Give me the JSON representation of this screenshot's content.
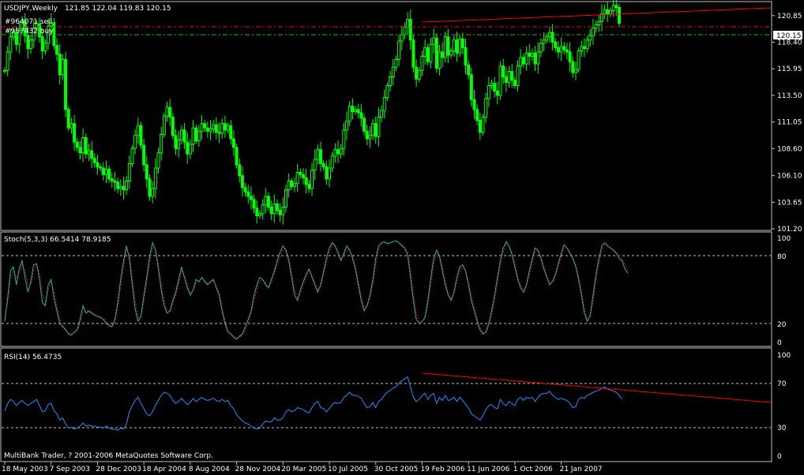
{
  "colors": {
    "background": "#000000",
    "frame": "#c0c0c0",
    "candle": "#00ff00",
    "trendline": "#ff0000",
    "sell_line": "#ff0000",
    "buy_line": "#00c000",
    "stoch_main": "#20b2aa",
    "stoch_signal": "#ff0000",
    "rsi": "#1e90ff",
    "text": "#ffffff"
  },
  "main_panel": {
    "symbol_label": "USDJPY,Weekly",
    "ohlc_label": "121.85 122.04 119.83 120.15",
    "order_sell_label": "#964071 sell",
    "order_buy_label": "#967432 buy",
    "price_ticks": [
      "120.85",
      "118.40",
      "115.95",
      "113.50",
      "111.05",
      "108.60",
      "106.10",
      "103.65",
      "101.20"
    ],
    "current_price": "120.15"
  },
  "stoch_panel": {
    "label": "Stoch(5,3,3) 66.5414 78.9185",
    "ticks": [
      "100",
      "80",
      "20",
      "0"
    ]
  },
  "rsi_panel": {
    "label": "RSI(14) 56.4735",
    "ticks": [
      "100",
      "70",
      "30",
      "0"
    ],
    "footer": "MultiBank Trader, ? 2001-2006 MetaQuotes Software Corp."
  },
  "time_axis": {
    "labels": [
      "18 May 2003",
      "7 Sep 2003",
      "28 Dec 2003",
      "18 Apr 2004",
      "8 Aug 2004",
      "28 Nov 2004",
      "20 Mar 2005",
      "10 Jul 2005",
      "30 Oct 2005",
      "19 Feb 2006",
      "11 Jun 2006",
      "1 Oct 2006",
      "21 Jan 2007"
    ]
  },
  "chart_data": [
    {
      "type": "candlestick",
      "ylim": [
        101.2,
        122.0
      ],
      "closes": [
        115.8,
        117.5,
        118.9,
        119.3,
        118.2,
        119.5,
        120.4,
        119.0,
        117.8,
        118.6,
        119.7,
        120.1,
        118.9,
        117.6,
        118.3,
        119.9,
        120.2,
        118.1,
        117.3,
        115.4,
        116.8,
        112.2,
        110.5,
        110.9,
        109.2,
        108.7,
        108.2,
        109.6,
        108.1,
        108.4,
        107.7,
        107.3,
        106.9,
        106.8,
        106.2,
        106.7,
        105.8,
        105.6,
        105.5,
        104.9,
        105.1,
        104.8,
        105.6,
        107.2,
        108.6,
        109.8,
        110.7,
        108.9,
        107.1,
        105.8,
        104.2,
        104.9,
        106.8,
        108.2,
        109.9,
        111.6,
        112.4,
        111.5,
        109.8,
        108.6,
        109.4,
        110.3,
        109.2,
        108.1,
        109.0,
        110.5,
        109.3,
        110.2,
        110.9,
        110.5,
        110.2,
        110.4,
        110.8,
        110.1,
        110.0,
        110.9,
        110.3,
        110.7,
        109.5,
        108.7,
        107.1,
        106.1,
        105.0,
        104.6,
        104.2,
        103.9,
        103.1,
        102.4,
        102.6,
        103.4,
        104.2,
        103.2,
        102.6,
        103.5,
        102.9,
        102.5,
        103.2,
        104.8,
        105.6,
        105.1,
        105.4,
        106.4,
        106.2,
        105.9,
        105.3,
        104.9,
        106.6,
        107.6,
        108.5,
        107.2,
        106.9,
        105.8,
        106.8,
        107.9,
        108.5,
        108.1,
        108.6,
        110.3,
        111.1,
        112.5,
        112.0,
        112.2,
        111.9,
        111.4,
        110.2,
        109.5,
        109.8,
        110.9,
        109.7,
        111.5,
        112.1,
        113.3,
        114.4,
        115.2,
        116.1,
        116.8,
        118.5,
        119.1,
        119.8,
        120.5,
        118.6,
        116.1,
        115.0,
        115.8,
        117.1,
        117.9,
        116.6,
        118.2,
        118.8,
        116.0,
        117.5,
        117.0,
        118.9,
        117.2,
        117.6,
        118.6,
        117.4,
        118.7,
        117.9,
        116.3,
        115.4,
        113.1,
        112.2,
        111.2,
        110.1,
        111.5,
        113.2,
        114.4,
        114.6,
        113.9,
        113.5,
        116.2,
        115.2,
        114.7,
        115.7,
        114.9,
        114.4,
        116.2,
        117.0,
        116.4,
        117.4,
        117.1,
        117.4,
        116.4,
        117.5,
        118.3,
        118.6,
        118.9,
        119.3,
        118.4,
        117.9,
        117.5,
        118.0,
        117.7,
        117.5,
        116.6,
        115.6,
        115.9,
        117.6,
        118.0,
        117.8,
        118.6,
        119.0,
        119.7,
        120.0,
        120.3,
        121.0,
        121.4,
        121.0,
        121.3,
        121.8,
        121.6,
        120.15
      ]
    },
    {
      "type": "line",
      "name": "Stoch(5,3,3)",
      "ylim": [
        0,
        100
      ],
      "series": [
        {
          "name": "main",
          "values": [
            20,
            42,
            68,
            72,
            55,
            70,
            78,
            62,
            48,
            58,
            74,
            75,
            60,
            38,
            35,
            55,
            60,
            42,
            30,
            18,
            15,
            12,
            8,
            7,
            10,
            12,
            22,
            35,
            28,
            30,
            28,
            26,
            25,
            24,
            22,
            18,
            16,
            15,
            22,
            38,
            60,
            78,
            92,
            80,
            55,
            32,
            20,
            25,
            45,
            62,
            82,
            95,
            88,
            70,
            50,
            35,
            28,
            30,
            40,
            48,
            60,
            72,
            62,
            52,
            45,
            50,
            60,
            58,
            62,
            58,
            55,
            58,
            60,
            52,
            45,
            30,
            18,
            10,
            8,
            5,
            3,
            6,
            8,
            15,
            22,
            30,
            45,
            55,
            62,
            60,
            55,
            52,
            60,
            68,
            78,
            86,
            92,
            88,
            78,
            62,
            45,
            40,
            50,
            58,
            65,
            70,
            62,
            55,
            48,
            55,
            68,
            80,
            90,
            95,
            92,
            85,
            78,
            85,
            92,
            88,
            80,
            70,
            55,
            40,
            30,
            35,
            45,
            60,
            80,
            92,
            95,
            96,
            94,
            95,
            96,
            97,
            95,
            92,
            90,
            84,
            62,
            40,
            22,
            18,
            20,
            24,
            40,
            62,
            80,
            88,
            82,
            68,
            55,
            45,
            40,
            48,
            62,
            72,
            74,
            68,
            55,
            40,
            30,
            20,
            12,
            8,
            10,
            18,
            30,
            45,
            62,
            78,
            90,
            96,
            92,
            84,
            72,
            60,
            52,
            48,
            55,
            68,
            80,
            90,
            88,
            80,
            70,
            62,
            55,
            58,
            65,
            75,
            85,
            93,
            90,
            85,
            80,
            72,
            60,
            45,
            28,
            20,
            26,
            45,
            65,
            80,
            92,
            95,
            92,
            90,
            88,
            85,
            80,
            78,
            70,
            66
          ]
        },
        {
          "name": "signal",
          "values": [
            25,
            38,
            60,
            70,
            62,
            66,
            74,
            68,
            56,
            55,
            68,
            74,
            66,
            46,
            38,
            50,
            58,
            48,
            34,
            22,
            16,
            13,
            9,
            8,
            9,
            11,
            18,
            30,
            30,
            30,
            29,
            27,
            25,
            24,
            23,
            20,
            17,
            15,
            19,
            33,
            54,
            72,
            88,
            84,
            62,
            40,
            24,
            24,
            40,
            57,
            76,
            90,
            90,
            75,
            55,
            40,
            30,
            29,
            37,
            45,
            56,
            68,
            64,
            55,
            47,
            49,
            57,
            58,
            61,
            59,
            56,
            57,
            59,
            54,
            47,
            34,
            21,
            12,
            8,
            6,
            4,
            5,
            7,
            12,
            19,
            27,
            40,
            51,
            58,
            60,
            57,
            53,
            57,
            65,
            74,
            82,
            89,
            89,
            81,
            66,
            50,
            42,
            47,
            55,
            62,
            68,
            64,
            57,
            50,
            53,
            64,
            76,
            86,
            93,
            92,
            87,
            80,
            83,
            89,
            88,
            82,
            73,
            58,
            44,
            33,
            34,
            42,
            55,
            74,
            88,
            93,
            95,
            94,
            95,
            96,
            96,
            95,
            93,
            90,
            86,
            68,
            46,
            28,
            20,
            20,
            23,
            35,
            55,
            74,
            85,
            84,
            72,
            59,
            48,
            42,
            46,
            58,
            68,
            72,
            69,
            58,
            44,
            33,
            22,
            14,
            9,
            9,
            15,
            26,
            40,
            57,
            73,
            86,
            94,
            92,
            86,
            75,
            63,
            55,
            50,
            54,
            64,
            76,
            87,
            88,
            82,
            73,
            64,
            57,
            57,
            63,
            72,
            82,
            90,
            90,
            86,
            81,
            74,
            63,
            48,
            32,
            22,
            24,
            40,
            59,
            75,
            88,
            93,
            92,
            90,
            88,
            86,
            82,
            79,
            74,
            70
          ]
        }
      ]
    },
    {
      "type": "line",
      "name": "RSI(14)",
      "ylim": [
        0,
        100
      ],
      "series": [
        {
          "name": "RSI",
          "values": [
            45,
            52,
            56,
            54,
            50,
            53,
            55,
            52,
            50,
            52,
            54,
            56,
            50,
            44,
            45,
            51,
            52,
            45,
            42,
            36,
            38,
            32,
            28,
            29,
            27,
            28,
            30,
            33,
            30,
            31,
            30,
            30,
            29,
            29,
            28,
            30,
            28,
            27,
            27,
            26,
            28,
            27,
            32,
            44,
            50,
            55,
            58,
            52,
            47,
            42,
            40,
            44,
            50,
            55,
            60,
            63,
            62,
            60,
            55,
            52,
            54,
            57,
            54,
            51,
            53,
            57,
            54,
            56,
            58,
            56,
            55,
            56,
            57,
            55,
            54,
            56,
            54,
            55,
            50,
            47,
            41,
            38,
            35,
            33,
            32,
            30,
            28,
            27,
            28,
            32,
            35,
            34,
            34,
            38,
            36,
            36,
            38,
            44,
            46,
            44,
            45,
            48,
            47,
            46,
            44,
            43,
            48,
            52,
            54,
            48,
            47,
            44,
            47,
            51,
            53,
            52,
            53,
            58,
            60,
            63,
            60,
            60,
            59,
            57,
            52,
            48,
            49,
            53,
            48,
            54,
            56,
            60,
            63,
            65,
            67,
            68,
            72,
            74,
            76,
            78,
            68,
            58,
            54,
            56,
            60,
            62,
            56,
            60,
            62,
            52,
            58,
            55,
            60,
            55,
            56,
            58,
            54,
            58,
            55,
            51,
            48,
            42,
            40,
            38,
            36,
            40,
            46,
            50,
            51,
            48,
            47,
            56,
            52,
            50,
            54,
            52,
            50,
            56,
            58,
            55,
            58,
            57,
            58,
            54,
            58,
            61,
            62,
            62,
            64,
            60,
            58,
            56,
            57,
            56,
            55,
            52,
            48,
            49,
            56,
            58,
            57,
            60,
            61,
            63,
            64,
            65,
            67,
            68,
            66,
            65,
            64,
            63,
            60,
            56.47
          ]
        }
      ]
    }
  ]
}
